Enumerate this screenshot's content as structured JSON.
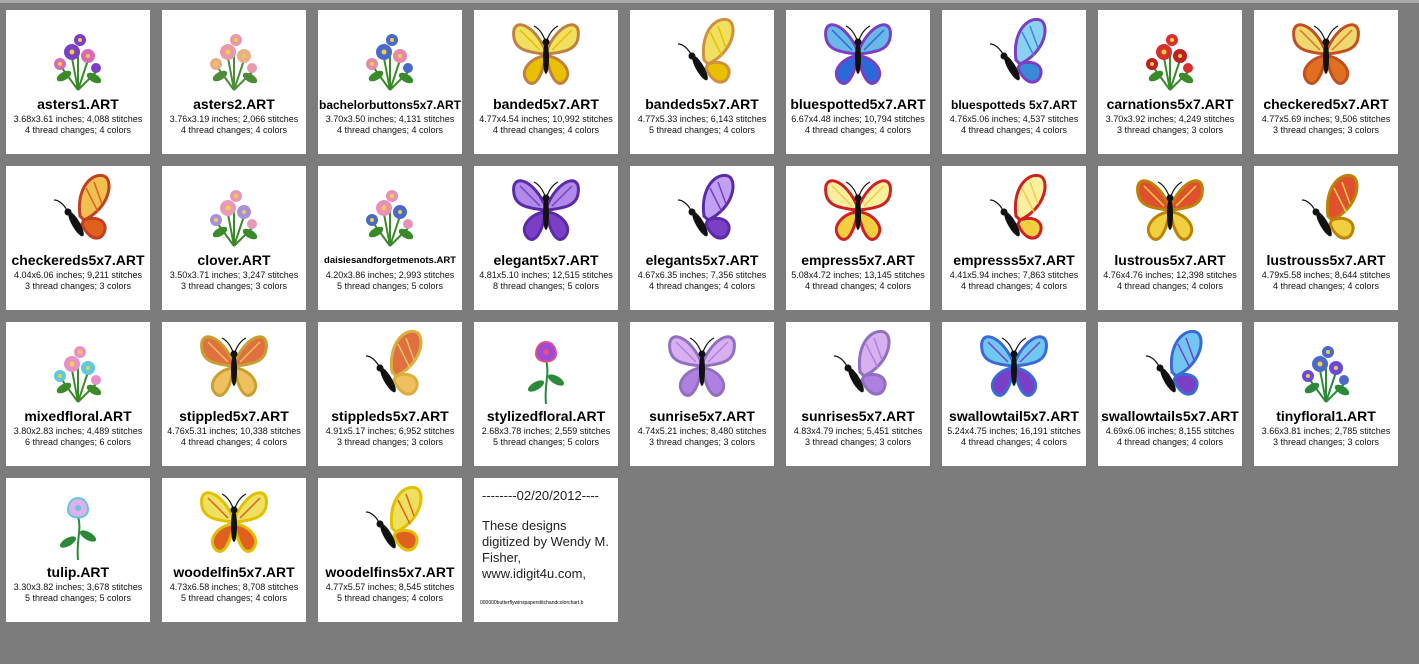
{
  "tiles": [
    {
      "name": "asters1.ART",
      "line1": "3.68x3.61 inches; 4,088 stitches",
      "line2": "4 thread changes; 4 colors",
      "icon": "flower-bouquet-icon",
      "colors": [
        "#7a3fc4",
        "#d86ab8",
        "#3a8a2a"
      ]
    },
    {
      "name": "asters2.ART",
      "line1": "3.76x3.19 inches; 2,066 stitches",
      "line2": "4 thread changes; 4 colors",
      "icon": "flower-spray-icon",
      "colors": [
        "#e89aa8",
        "#e7b08a",
        "#4d8a3a"
      ]
    },
    {
      "name": "bachelorbuttons5x7.ART",
      "line1": "3.70x3.50 inches; 4,131 stitches",
      "line2": "4 thread changes; 4 colors",
      "icon": "flower-bouquet-icon",
      "colors": [
        "#4a69c8",
        "#e58aa8",
        "#3a8a2a"
      ]
    },
    {
      "name": "banded5x7.ART",
      "line1": "4.77x4.54 inches; 10,992 stitches",
      "line2": "4 thread changes; 4 colors",
      "icon": "butterfly-icon",
      "colors": [
        "#f0e060",
        "#e8c000",
        "#c08040"
      ]
    },
    {
      "name": "bandeds5x7.ART",
      "line1": "4.77x5.33 inches; 6,143 stitches",
      "line2": "5 thread changes; 4 colors",
      "icon": "butterfly-side-icon",
      "colors": [
        "#f0e060",
        "#e8c000",
        "#d09040"
      ]
    },
    {
      "name": "bluespotted5x7.ART",
      "line1": "6.67x4.48 inches; 10,794 stitches",
      "line2": "4 thread changes; 4 colors",
      "icon": "butterfly-icon",
      "colors": [
        "#6ab8e8",
        "#2a6ad8",
        "#7a3fc4"
      ]
    },
    {
      "name": "bluespotteds 5x7.ART",
      "line1": "4.76x5.06 inches; 4,537 stitches",
      "line2": "4 thread changes; 4 colors",
      "icon": "butterfly-side-icon",
      "colors": [
        "#8ad0f0",
        "#3a8ad8",
        "#7a3fc4"
      ]
    },
    {
      "name": "carnations5x7.ART",
      "line1": "3.70x3.92 inches; 4,249 stitches",
      "line2": "3 thread changes; 3 colors",
      "icon": "flower-bouquet-icon",
      "colors": [
        "#d83030",
        "#c02020",
        "#3a8a2a"
      ]
    },
    {
      "name": "checkered5x7.ART",
      "line1": "4.77x5.69 inches; 9,506 stitches",
      "line2": "3 thread changes; 3 colors",
      "icon": "butterfly-icon",
      "colors": [
        "#f0d870",
        "#e07020",
        "#c05020"
      ]
    },
    {
      "name": "checkereds5x7.ART",
      "line1": "4.04x6.06 inches; 9,211 stitches",
      "line2": "3 thread changes; 3 colors",
      "icon": "butterfly-side-icon",
      "colors": [
        "#f0c050",
        "#e06020",
        "#c04020"
      ]
    },
    {
      "name": "clover.ART",
      "line1": "3.50x3.71 inches; 3,247 stitches",
      "line2": "3 thread changes; 3 colors",
      "icon": "flower-bouquet-icon",
      "colors": [
        "#e89ab8",
        "#a890e0",
        "#3a8a2a"
      ]
    },
    {
      "name": "daisiesandforgetmenots.ART",
      "line1": "4.20x3.86 inches; 2,993 stitches",
      "line2": "5 thread changes; 5 colors",
      "icon": "flower-bouquet-icon",
      "colors": [
        "#e890b8",
        "#4a69c8",
        "#3a8a2a"
      ]
    },
    {
      "name": "elegant5x7.ART",
      "line1": "4.81x5.10 inches; 12,515 stitches",
      "line2": "8 thread changes; 5 colors",
      "icon": "butterfly-icon",
      "colors": [
        "#b08ae8",
        "#7a3fc4",
        "#5a2aa8"
      ]
    },
    {
      "name": "elegants5x7.ART",
      "line1": "4.67x6.35 inches; 7,356 stitches",
      "line2": "4 thread changes; 4 colors",
      "icon": "butterfly-side-icon",
      "colors": [
        "#c0a0f0",
        "#7a3fc4",
        "#5a2aa8"
      ]
    },
    {
      "name": "empress5x7.ART",
      "line1": "5.08x4.72 inches; 13,145 stitches",
      "line2": "4 thread changes; 4 colors",
      "icon": "butterfly-icon",
      "colors": [
        "#f8f0a0",
        "#f0d040",
        "#d02020"
      ]
    },
    {
      "name": "empresss5x7.ART",
      "line1": "4.41x5.94 inches; 7,863 stitches",
      "line2": "4 thread changes; 4 colors",
      "icon": "butterfly-side-icon",
      "colors": [
        "#f8f0a0",
        "#f0d040",
        "#d02020"
      ]
    },
    {
      "name": "lustrous5x7.ART",
      "line1": "4.76x4.76 inches; 12,398 stitches",
      "line2": "4 thread changes; 4 colors",
      "icon": "butterfly-icon",
      "colors": [
        "#e05030",
        "#f0d040",
        "#c08000"
      ]
    },
    {
      "name": "lustrouss5x7.ART",
      "line1": "4.79x5.58 inches; 8,644 stitches",
      "line2": "4 thread changes; 4 colors",
      "icon": "butterfly-side-icon",
      "colors": [
        "#e05030",
        "#f0d040",
        "#c08000"
      ]
    },
    {
      "name": "mixedfloral.ART",
      "line1": "3.80x2.83 inches; 4,489 stitches",
      "line2": "6 thread changes; 6 colors",
      "icon": "flower-bouquet-icon",
      "colors": [
        "#e890c8",
        "#60c8e0",
        "#3a8a2a"
      ]
    },
    {
      "name": "stippled5x7.ART",
      "line1": "4.76x5.31 inches; 10,338 stitches",
      "line2": "4 thread changes; 4 colors",
      "icon": "butterfly-icon",
      "colors": [
        "#e07040",
        "#f0c060",
        "#c8a030"
      ]
    },
    {
      "name": "stippleds5x7.ART",
      "line1": "4.91x5.17 inches; 6,952 stitches",
      "line2": "3 thread changes; 3 colors",
      "icon": "butterfly-side-icon",
      "colors": [
        "#e07040",
        "#f0c060",
        "#d8b040"
      ]
    },
    {
      "name": "stylizedfloral.ART",
      "line1": "2.68x3.78 inches; 2,559 stitches",
      "line2": "5 thread changes; 5 colors",
      "icon": "flower-single-icon",
      "colors": [
        "#a04ad8",
        "#e05080",
        "#2a8a3a"
      ]
    },
    {
      "name": "sunrise5x7.ART",
      "line1": "4.74x5.21 inches; 8,480 stitches",
      "line2": "3 thread changes; 3 colors",
      "icon": "butterfly-icon",
      "colors": [
        "#d8b0f0",
        "#b080e0",
        "#9070c0"
      ]
    },
    {
      "name": "sunrises5x7.ART",
      "line1": "4.83x4.79 inches; 5,451 stitches",
      "line2": "3 thread changes; 3 colors",
      "icon": "butterfly-side-icon",
      "colors": [
        "#d8b0f0",
        "#b080e0",
        "#9070c0"
      ]
    },
    {
      "name": "swallowtail5x7.ART",
      "line1": "5.24x4.75 inches; 16,191 stitches",
      "line2": "4 thread changes; 4 colors",
      "icon": "butterfly-icon",
      "colors": [
        "#70c8f0",
        "#7a3fc4",
        "#3a6ad8"
      ]
    },
    {
      "name": "swallowtails5x7.ART",
      "line1": "4.69x6.06 inches; 8,155 stitches",
      "line2": "4 thread changes; 4 colors",
      "icon": "butterfly-side-icon",
      "colors": [
        "#70c8f0",
        "#7a3fc4",
        "#3a6ad8"
      ]
    },
    {
      "name": "tinyfloral1.ART",
      "line1": "3.66x3.81 inches; 2,785 stitches",
      "line2": "3 thread changes; 3 colors",
      "icon": "flower-bouquet-icon",
      "colors": [
        "#4a69c8",
        "#6a4ad8",
        "#2a8a3a"
      ]
    },
    {
      "name": "tulip.ART",
      "line1": "3.30x3.82 inches; 3,678 stitches",
      "line2": "5 thread changes; 5 colors",
      "icon": "flower-single-icon",
      "colors": [
        "#e0b0e8",
        "#60c8e0",
        "#2a8a3a"
      ]
    },
    {
      "name": "woodelfin5x7.ART",
      "line1": "4.73x6.58 inches; 8,708 stitches",
      "line2": "5 thread changes; 4 colors",
      "icon": "butterfly-icon",
      "colors": [
        "#f0e060",
        "#e06020",
        "#e0c000"
      ]
    },
    {
      "name": "woodelfins5x7.ART",
      "line1": "4.77x5.57 inches; 8,545 stitches",
      "line2": "5 thread changes; 4 colors",
      "icon": "butterfly-side-icon",
      "colors": [
        "#f0e060",
        "#e06020",
        "#e0c000"
      ]
    }
  ],
  "note": {
    "date": "--------02/20/2012----",
    "text": "These designs digitized by Wendy M. Fisher, www.idigit4u.com,",
    "filename": "000000butterflywinspaperstitchandcolorchart.b"
  }
}
